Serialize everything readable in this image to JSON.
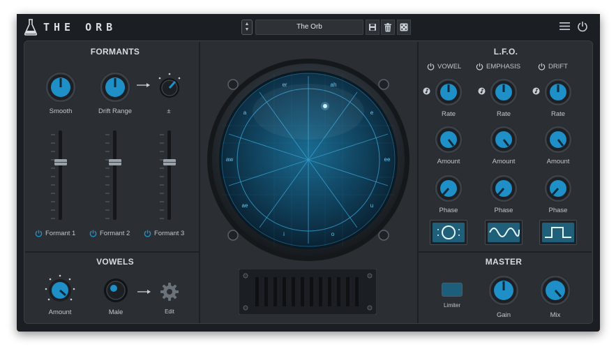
{
  "app": {
    "title": "THE ORB"
  },
  "header": {
    "preset_name": "The Orb"
  },
  "formants": {
    "title": "FORMANTS",
    "smooth_label": "Smooth",
    "drift_range_label": "Drift Range",
    "plusminus_label": "±",
    "formant1_label": "Formant 1",
    "formant2_label": "Formant 2",
    "formant3_label": "Formant 3"
  },
  "vowels": {
    "title": "VOWELS",
    "amount_label": "Amount",
    "male_label": "Male",
    "edit_label": "Edit"
  },
  "orb": {
    "vowel_labels": [
      "er",
      "ah",
      "e",
      "ee",
      "u",
      "o",
      "i",
      "ae",
      "aw",
      "a"
    ]
  },
  "lfo": {
    "title": "L.F.O.",
    "columns": [
      {
        "toggle_label": "VOWEL",
        "rate_label": "Rate",
        "amount_label": "Amount",
        "phase_label": "Phase",
        "waveform": "circle-wave-icon"
      },
      {
        "toggle_label": "EMPHASIS",
        "rate_label": "Rate",
        "amount_label": "Amount",
        "phase_label": "Phase",
        "waveform": "sine-wave-icon"
      },
      {
        "toggle_label": "DRIFT",
        "rate_label": "Rate",
        "amount_label": "Amount",
        "phase_label": "Phase",
        "waveform": "square-wave-icon"
      }
    ]
  },
  "master": {
    "title": "MASTER",
    "limiter_label": "Limiter",
    "gain_label": "Gain",
    "mix_label": "Mix"
  },
  "colors": {
    "accent": "#1e8fc7",
    "panel": "#2b2f34",
    "frame": "#1b1e22",
    "text": "#c9d0d6"
  }
}
